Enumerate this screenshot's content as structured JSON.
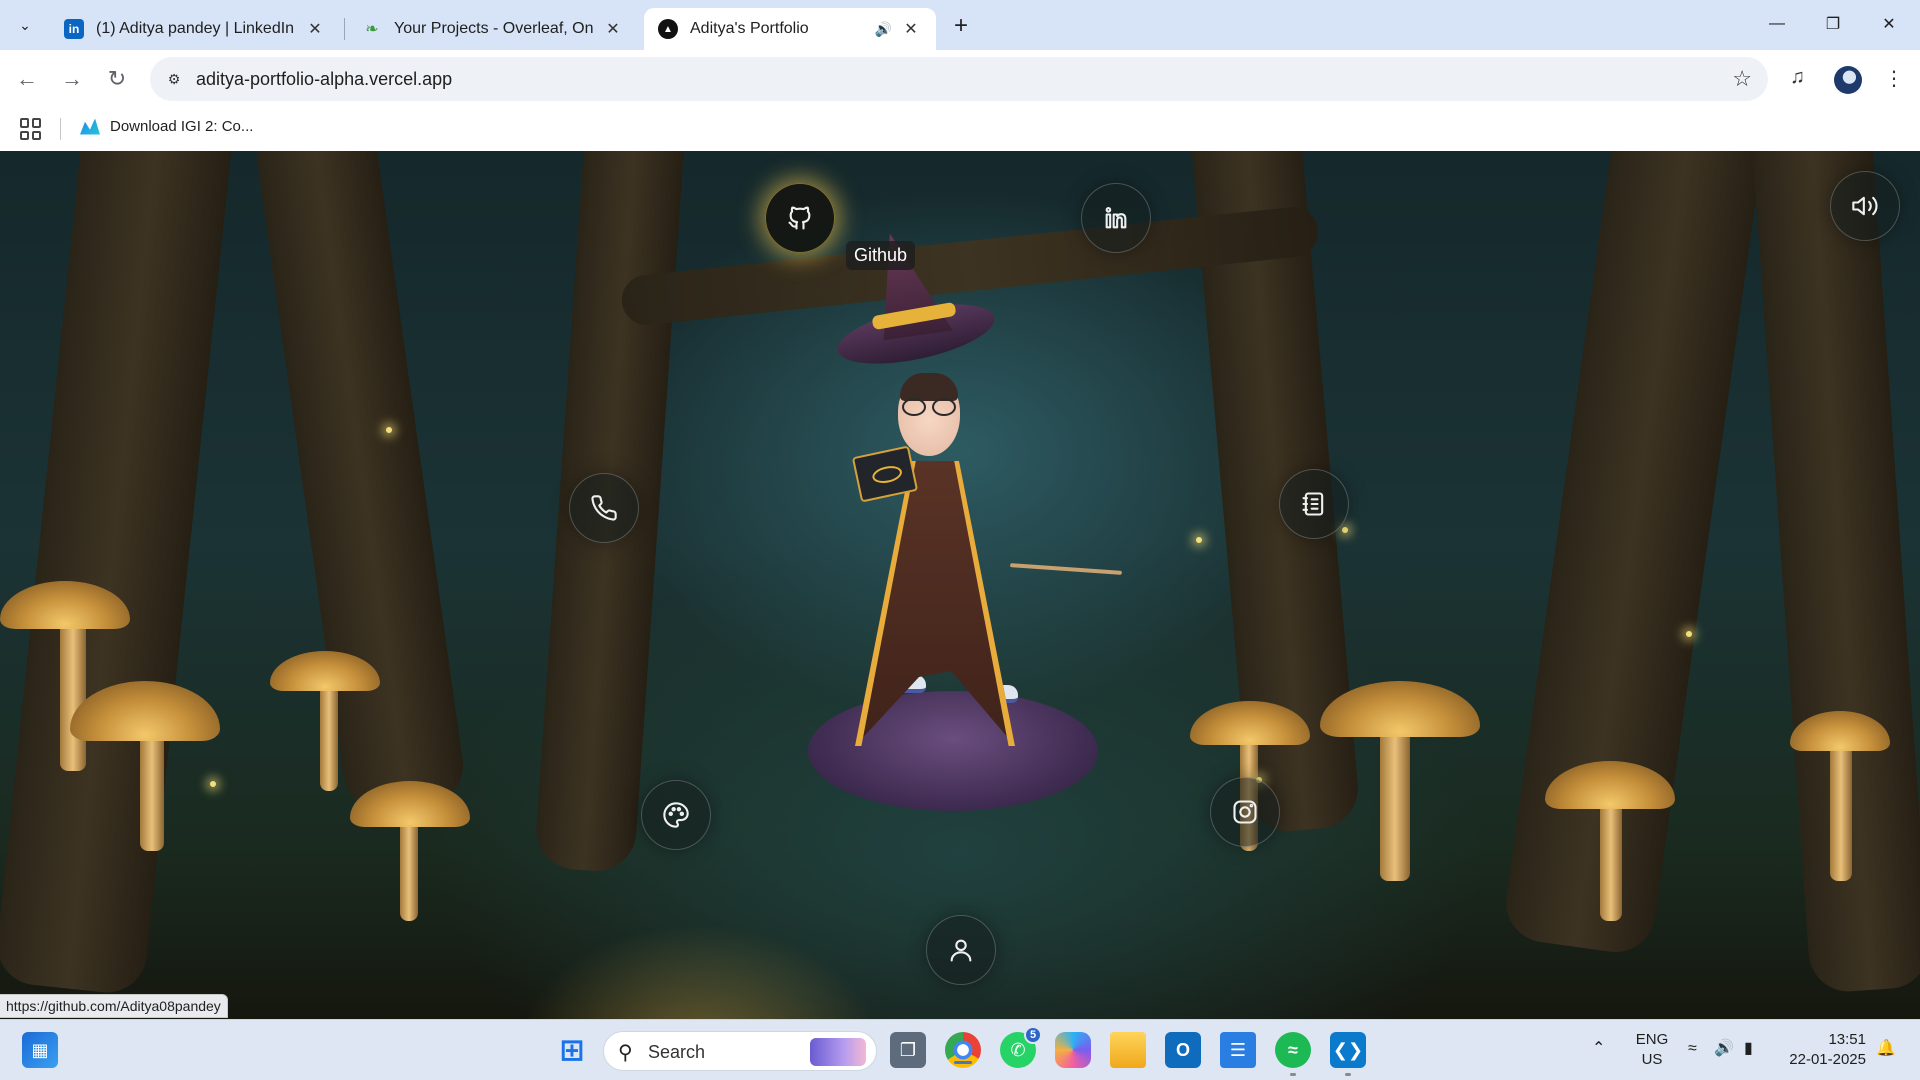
{
  "browser": {
    "tabs": [
      {
        "title": "(1) Aditya pandey | LinkedIn",
        "favicon": "linkedin-icon",
        "active": false
      },
      {
        "title": "Your Projects - Overleaf, Online",
        "favicon": "overleaf-icon",
        "active": false
      },
      {
        "title": "Aditya's Portfolio",
        "favicon": "vercel-icon",
        "active": true,
        "audio": true
      }
    ],
    "url": "aditya-portfolio-alpha.vercel.app",
    "bookmarks": [
      {
        "label": "Download IGI 2: Co...",
        "icon": "igi-icon"
      }
    ]
  },
  "page": {
    "nav_orbs": [
      {
        "name": "github",
        "icon": "github-icon",
        "hover": true
      },
      {
        "name": "linkedin",
        "icon": "linkedin-icon"
      },
      {
        "name": "phone",
        "icon": "phone-icon"
      },
      {
        "name": "resume",
        "icon": "notebook-icon"
      },
      {
        "name": "projects",
        "icon": "palette-icon"
      },
      {
        "name": "instagram",
        "icon": "instagram-icon"
      },
      {
        "name": "about",
        "icon": "user-icon"
      }
    ],
    "tooltip": "Github",
    "sound_button_icon": "speaker-icon"
  },
  "status_bar_url": "https://github.com/Aditya08pandey",
  "taskbar": {
    "search_label": "Search",
    "whatsapp_badge": "5",
    "language": "ENG",
    "region": "US",
    "time": "13:51",
    "date": "22-01-2025"
  },
  "colors": {
    "tab_strip": "#d7e3f6",
    "hover_glow": "#f0c850",
    "taskbar": "#dde6f2"
  }
}
